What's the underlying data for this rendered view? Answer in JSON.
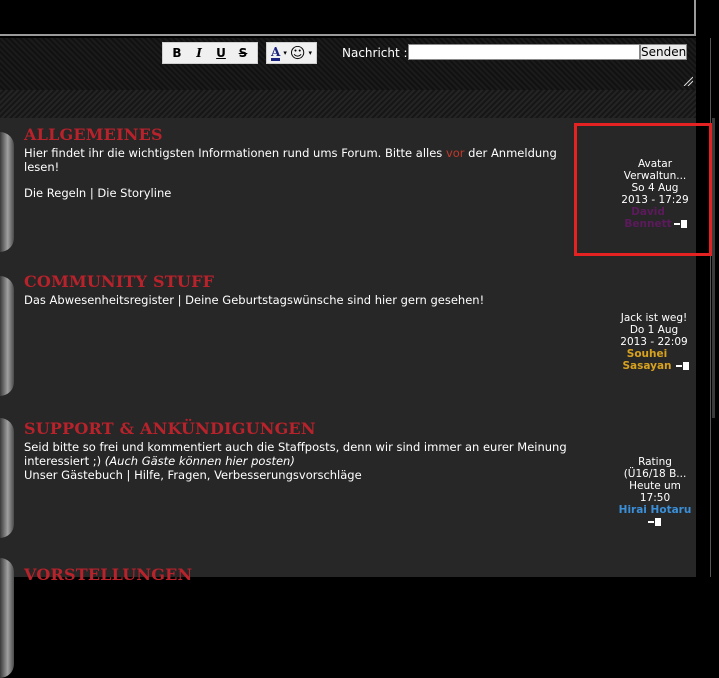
{
  "chat": {
    "bold": "B",
    "italic": "I",
    "underline": "U",
    "strike": "S",
    "color": "A",
    "dropdown_arrow": "▾",
    "smiley": "☺",
    "message_label": "Nachricht :",
    "message_value": "",
    "send_label": "Senden"
  },
  "forums": [
    {
      "title": "ALLGEMEINES",
      "desc_before": "Hier findet ihr die wichtigsten Informationen rund ums Forum. Bitte alles ",
      "desc_highlight": "vor",
      "desc_after": " der Anmeldung lesen!",
      "sub_1": "Die Regeln",
      "sep": "|",
      "sub_2": "Die Storyline",
      "last_topic_1": "Avatar",
      "last_topic_2": "Verwaltun...",
      "last_date_1": "So 4 Aug",
      "last_date_2": "2013 - 17:29",
      "last_user": "David Bennett",
      "user_color": "#5c1a5c"
    },
    {
      "title": "COMMUNITY STUFF",
      "desc": "Das Abwesenheitsregister | Deine Geburtstagswünsche sind hier gern gesehen!",
      "last_topic_1": "Jack ist weg!",
      "last_date_1": "Do 1 Aug",
      "last_date_2": "2013 - 22:09",
      "last_user": "Souhei Sasayan",
      "user_color": "#d8a21f"
    },
    {
      "title": "SUPPORT & ANKÜNDIGUNGEN",
      "desc_1": "Seid bitte so frei und kommentiert auch die Staffposts, denn wir sind immer an eurer Meinung interessiert ;)",
      "desc_em": "(Auch Gäste können hier posten)",
      "sub_1": "Unser Gästebuch",
      "sep": "|",
      "sub_2": "Hilfe, Fragen, Verbesserungsvorschläge",
      "last_topic_1": "Rating",
      "last_topic_2": "(Ü16/18 B...",
      "last_date_1": "Heute um",
      "last_date_2": "17:50",
      "last_user": "Hirai Hotaru",
      "user_color": "#3a8fd8"
    },
    {
      "title": "VORSTELLUNGEN"
    }
  ]
}
